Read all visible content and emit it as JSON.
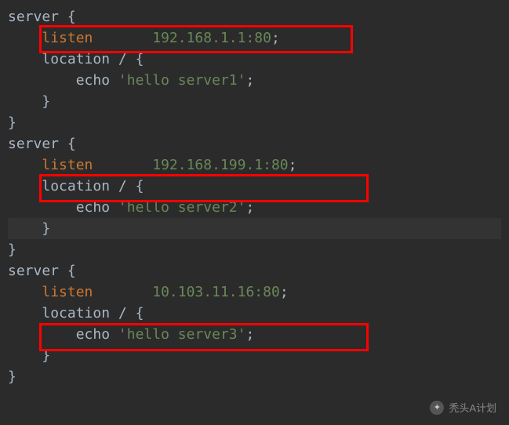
{
  "servers": [
    {
      "keyword_server": "server",
      "keyword_listen": "listen",
      "listen_value": "192.168.1.1:80",
      "keyword_location": "location",
      "location_path": "/",
      "keyword_echo": "echo",
      "echo_value": "'hello server1'"
    },
    {
      "keyword_server": "server",
      "keyword_listen": "listen",
      "listen_value": "192.168.199.1:80",
      "keyword_location": "location",
      "location_path": "/",
      "keyword_echo": "echo",
      "echo_value": "'hello server2'"
    },
    {
      "keyword_server": "server",
      "keyword_listen": "listen",
      "listen_value": "10.103.11.16:80",
      "keyword_location": "location",
      "location_path": "/",
      "keyword_echo": "echo",
      "echo_value": "'hello server3'"
    }
  ],
  "braces": {
    "open": "{",
    "close": "}"
  },
  "punctuation": {
    "semi": ";"
  },
  "watermark": "秃头A计划"
}
